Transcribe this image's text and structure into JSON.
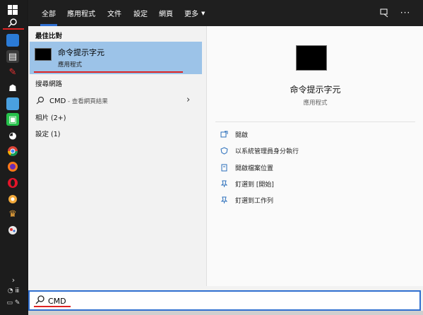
{
  "taskbar": {
    "icons": [
      "windows-logo-icon",
      "search-icon",
      "monitor-icon",
      "app-icon",
      "app-icon",
      "alien-icon",
      "notebook-icon",
      "chat-icon",
      "game-icon",
      "chrome-icon",
      "firefox-icon",
      "opera-icon",
      "app-icon",
      "app-icon",
      "app-icon"
    ],
    "tray": [
      "chevron-up-icon",
      "network-icon",
      "speech-icon"
    ]
  },
  "tabs": [
    {
      "label": "全部",
      "active": true
    },
    {
      "label": "應用程式"
    },
    {
      "label": "文件"
    },
    {
      "label": "設定"
    },
    {
      "label": "網頁"
    },
    {
      "label": "更多"
    }
  ],
  "left": {
    "best_match_label": "最佳比對",
    "best": {
      "title": "命令提示字元",
      "subtitle": "應用程式"
    },
    "web_label": "搜尋網路",
    "web_query": "CMD",
    "web_suffix": " - 查看網頁結果",
    "photos": "相片 (2+)",
    "settings": "設定 (1)"
  },
  "preview": {
    "title": "命令提示字元",
    "subtitle": "應用程式",
    "actions": [
      {
        "label": "開啟",
        "icon": "open-icon"
      },
      {
        "label": "以系統管理員身分執行",
        "icon": "shield-icon"
      },
      {
        "label": "開啟檔案位置",
        "icon": "folder-icon"
      },
      {
        "label": "釘選到 [開始]",
        "icon": "pin-icon"
      },
      {
        "label": "釘選到工作列",
        "icon": "pin-icon"
      }
    ]
  },
  "search": {
    "value": "CMD"
  },
  "colors": {
    "accent": "#2f6fd0",
    "selection": "#9cc3e8",
    "underline": "#dd2222"
  }
}
